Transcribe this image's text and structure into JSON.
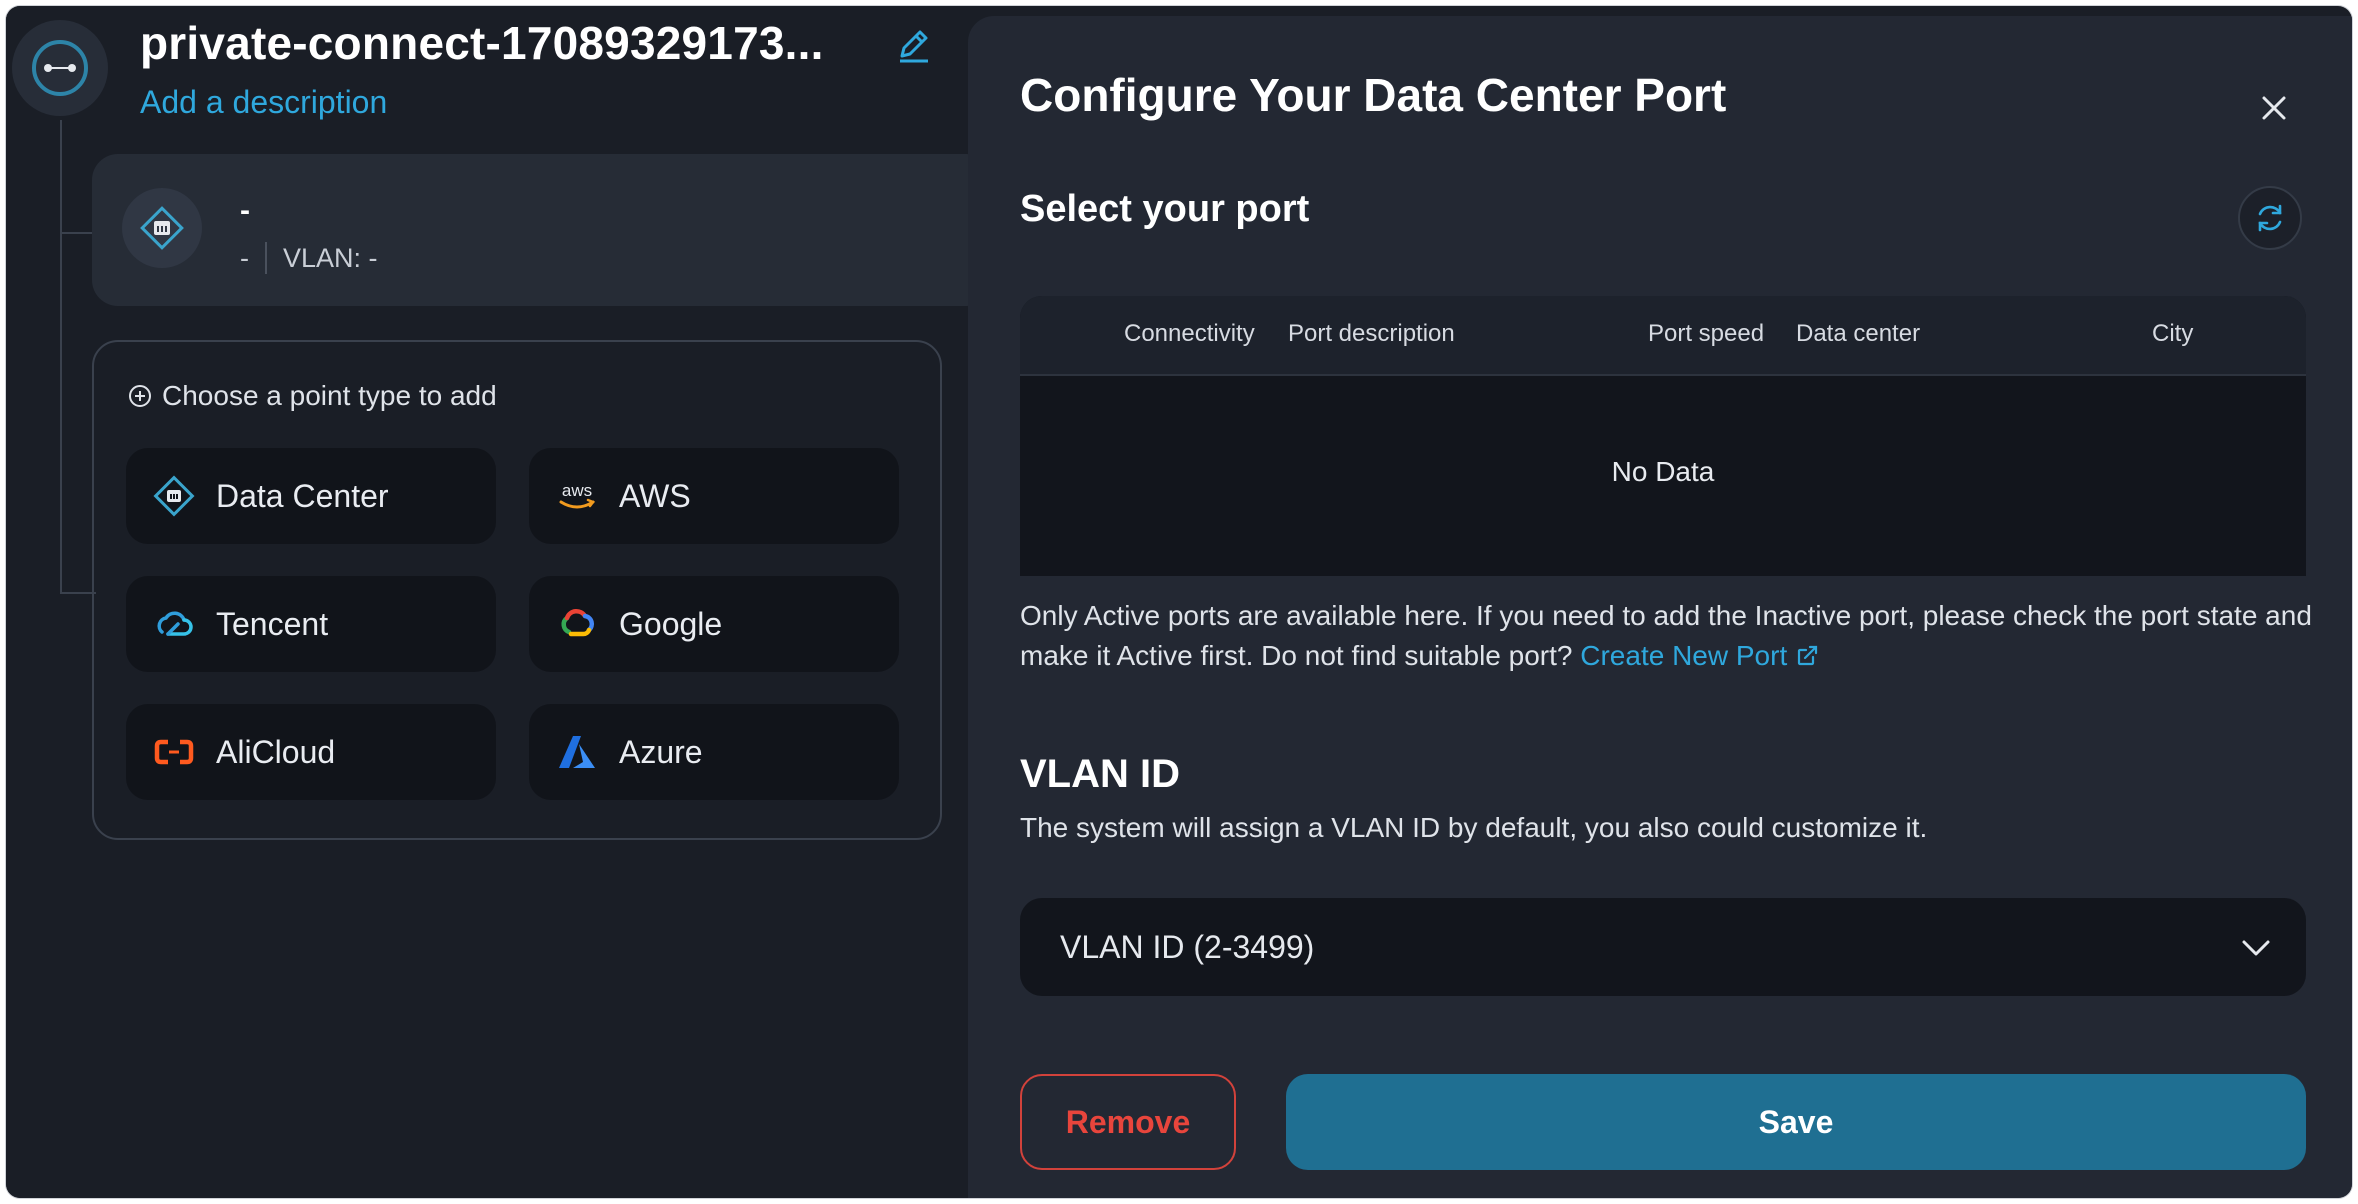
{
  "connection": {
    "title": "private-connect-17089329173...",
    "add_description": "Add a description"
  },
  "endpoint": {
    "name": "-",
    "port": "-",
    "vlan": "VLAN: -"
  },
  "point_types": {
    "hint": "Choose a point type to add",
    "items": [
      {
        "label": "Data Center",
        "icon": "data-center-icon"
      },
      {
        "label": "AWS",
        "icon": "aws-icon"
      },
      {
        "label": "Tencent",
        "icon": "tencent-icon"
      },
      {
        "label": "Google",
        "icon": "google-icon"
      },
      {
        "label": "AliCloud",
        "icon": "alicloud-icon"
      },
      {
        "label": "Azure",
        "icon": "azure-icon"
      }
    ]
  },
  "panel": {
    "title": "Configure Your Data Center Port",
    "select_port_title": "Select your port",
    "table": {
      "columns": [
        "Connectivity",
        "Port description",
        "Port speed",
        "Data center",
        "City"
      ],
      "empty_text": "No Data"
    },
    "note_text": "Only Active ports are available here. If you need to add the Inactive port, please check the port state and make it Active first. Do not find suitable port?",
    "create_port_link": "Create New Port",
    "vlan_title": "VLAN ID",
    "vlan_desc": "The system will assign a VLAN ID by default, you also could customize it.",
    "vlan_placeholder": "VLAN ID (2-3499)",
    "remove_label": "Remove",
    "save_label": "Save"
  },
  "colors": {
    "background": "#1a1e26",
    "panel": "#232833",
    "accent_link": "#2fa8dd",
    "save_button": "#1f6f92",
    "remove_button": "#e8453c"
  }
}
